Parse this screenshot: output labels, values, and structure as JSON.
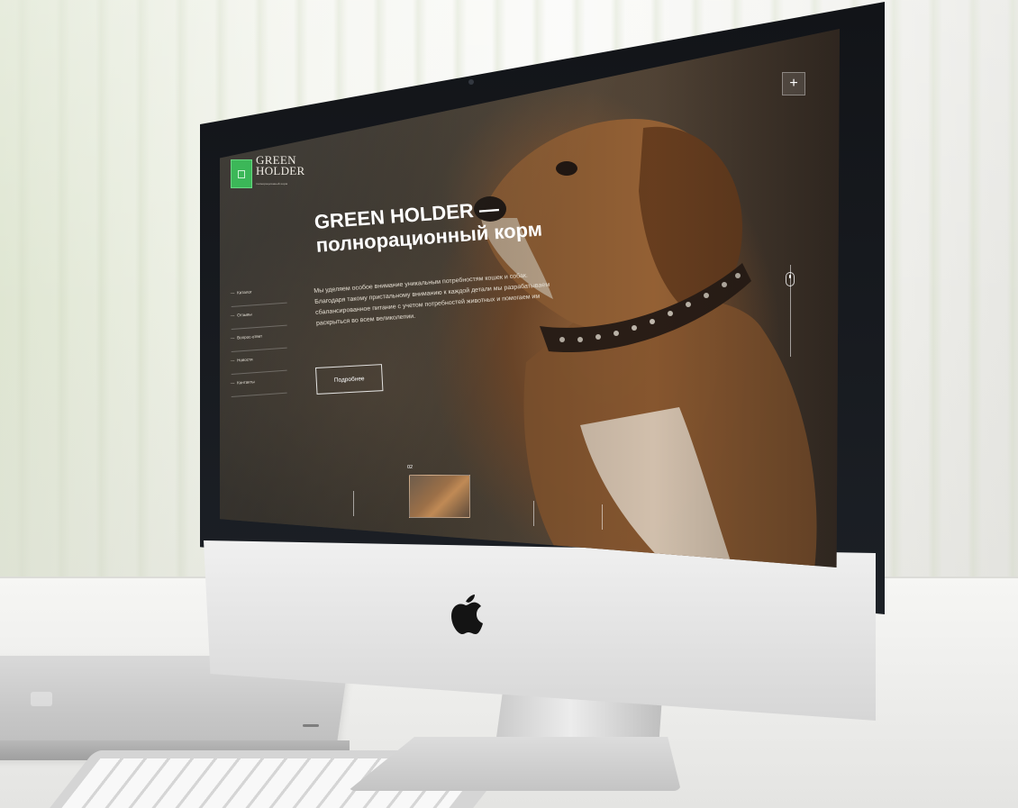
{
  "site": {
    "logo_text_line1": "GREEN",
    "logo_text_line2": "HOLDER",
    "logo_tagline": "полнорационный корм",
    "hero_title_line1": "GREEN HOLDER —",
    "hero_title_line2": "полнорационный корм",
    "hero_text": "Мы уделяем особое внимание уникальным потребностям кошек и собак. Благодаря такому пристальному вниманию к каждой детали мы разрабатываем сбалансированное питание с учетом потребностей животных и помогаем им раскрыться во всем великолепии.",
    "more_button": "Подробнее",
    "plus_button": "+",
    "slide_number": "02",
    "nav": [
      {
        "label": "Каталог"
      },
      {
        "label": "Отзывы"
      },
      {
        "label": "Вопрос-ответ"
      },
      {
        "label": "Новости"
      },
      {
        "label": "Контакты"
      }
    ]
  },
  "colors": {
    "brand_green": "#2bb14a",
    "screen_dark": "#3f3a33",
    "text_light": "#ffffff"
  },
  "icons": {
    "plus": "plus-icon",
    "scroll": "scroll-mouse-icon",
    "apple": "apple-logo-icon"
  }
}
